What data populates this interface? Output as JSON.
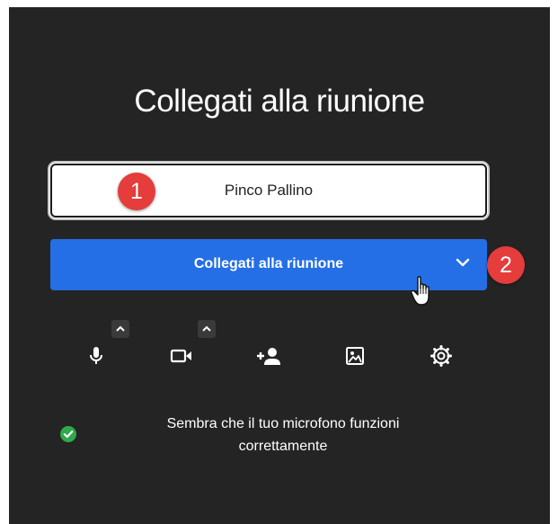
{
  "dialog": {
    "title": "Collegati alla riunione",
    "name_input": {
      "value": "Pinco Pallino",
      "placeholder": ""
    },
    "join_button": {
      "label": "Collegati alla riunione"
    },
    "annotations": [
      "1",
      "2"
    ]
  },
  "toolbar": {
    "icons": [
      "microphone-icon",
      "camera-icon",
      "invite-person-icon",
      "background-image-icon",
      "settings-gear-icon"
    ]
  },
  "status": {
    "message": "Sembra che il tuo microfono funzioni correttamente",
    "icon": "check-circle-icon",
    "color": "#2eaa4a"
  },
  "colors": {
    "panel_bg": "#242424",
    "join_button": "#246fe5",
    "annotation_badge": "#e53c3c"
  }
}
